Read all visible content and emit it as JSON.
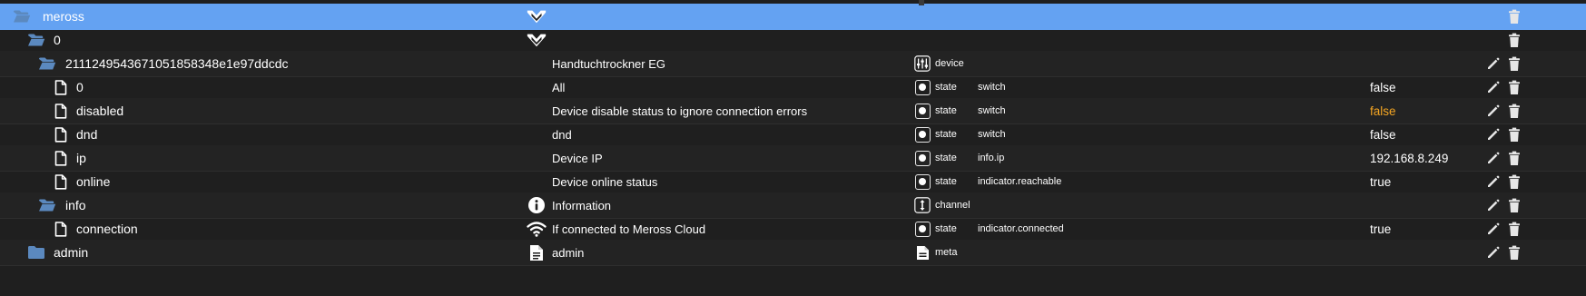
{
  "rows": [
    {
      "id": "meross",
      "folder": true,
      "name": "",
      "name_icon": "meross-logo-icon",
      "type": "",
      "type_icon": "",
      "role": "",
      "value": "",
      "edit": false
    },
    {
      "id": "0",
      "folder": true,
      "name": "",
      "name_icon": "meross-logo-icon",
      "type": "",
      "type_icon": "",
      "role": "",
      "value": "",
      "edit": false
    },
    {
      "id": "2111249543671051858348e1e97ddcdc",
      "folder": true,
      "name": "Handtuchtrockner EG",
      "name_icon": "",
      "type": "device",
      "type_icon": "device-icon",
      "role": "",
      "value": "",
      "edit": true
    },
    {
      "id": "0",
      "folder": false,
      "name": "All",
      "name_icon": "",
      "type": "state",
      "type_icon": "state-icon",
      "role": "switch",
      "value": "false",
      "edit": true
    },
    {
      "id": "disabled",
      "folder": false,
      "name": "Device disable status to ignore connection errors",
      "name_icon": "",
      "type": "state",
      "type_icon": "state-icon",
      "role": "switch",
      "value": "false",
      "value_warn": true,
      "edit": true
    },
    {
      "id": "dnd",
      "folder": false,
      "name": "dnd",
      "name_icon": "",
      "type": "state",
      "type_icon": "state-icon",
      "role": "switch",
      "value": "false",
      "edit": true
    },
    {
      "id": "ip",
      "folder": false,
      "name": "Device IP",
      "name_icon": "",
      "type": "state",
      "type_icon": "state-icon",
      "role": "info.ip",
      "value": "192.168.8.249",
      "edit": true
    },
    {
      "id": "online",
      "folder": false,
      "name": "Device online status",
      "name_icon": "",
      "type": "state",
      "type_icon": "state-icon",
      "role": "indicator.reachable",
      "value": "true",
      "edit": true
    },
    {
      "id": "info",
      "folder": true,
      "name": "Information",
      "name_icon": "info-circle-icon",
      "type": "channel",
      "type_icon": "channel-icon",
      "role": "",
      "value": "",
      "edit": true
    },
    {
      "id": "connection",
      "folder": false,
      "name": "If connected to Meross Cloud",
      "name_icon": "wifi-icon",
      "type": "state",
      "type_icon": "state-icon",
      "role": "indicator.connected",
      "value": "true",
      "edit": true
    },
    {
      "id": "admin",
      "folder": true,
      "name": "admin",
      "name_icon": "document-icon",
      "type": "meta",
      "type_icon": "meta-icon",
      "role": "",
      "value": "",
      "edit": true
    }
  ],
  "colors": {
    "selected_row": "#64a2f2",
    "folder": "#5b89bf",
    "warning_value": "#f5a623",
    "background": "#1f1f1f"
  }
}
